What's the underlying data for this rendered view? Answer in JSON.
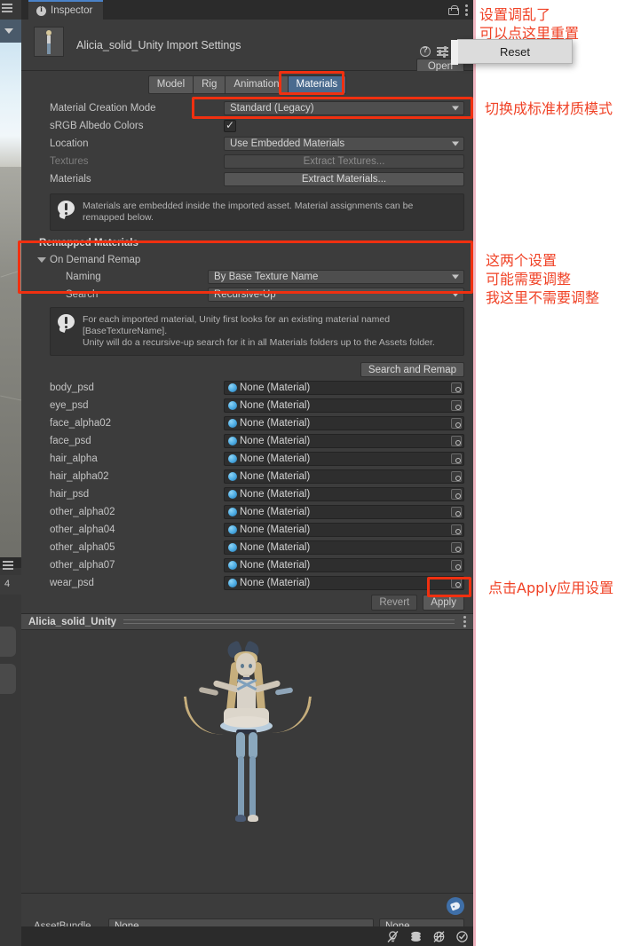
{
  "window": {
    "tab_title": "Inspector",
    "lock_icon": "lock-icon",
    "menu_icon": "kebab-menu-icon"
  },
  "asset_header": {
    "title": "Alicia_solid_Unity Import Settings",
    "help_icon": "help-icon",
    "preset_icon": "preset-icon",
    "menu_icon": "kebab-menu-icon",
    "open_button": "Open"
  },
  "context_menu": {
    "items": [
      "Reset"
    ]
  },
  "tabs": [
    {
      "label": "Model",
      "active": false
    },
    {
      "label": "Rig",
      "active": false
    },
    {
      "label": "Animation",
      "active": false
    },
    {
      "label": "Materials",
      "active": true
    }
  ],
  "material_settings": {
    "creation_mode_label": "Material Creation Mode",
    "creation_mode_value": "Standard (Legacy)",
    "srgb_label": "sRGB Albedo Colors",
    "srgb_checked": true,
    "location_label": "Location",
    "location_value": "Use Embedded Materials",
    "textures_label": "Textures",
    "textures_button": "Extract Textures...",
    "materials_label": "Materials",
    "materials_button": "Extract Materials...",
    "info_text": "Materials are embedded inside the imported asset. Material assignments can be remapped below."
  },
  "remapped": {
    "section_title": "Remapped Materials",
    "fold_label": "On Demand Remap",
    "naming_label": "Naming",
    "naming_value": "By Base Texture Name",
    "search_label": "Search",
    "search_value": "Recursive-Up",
    "info_text": "For each imported material, Unity first looks for an existing material named [BaseTextureName].\nUnity will do a recursive-up search for it in all Materials folders up to the Assets folder.",
    "search_remap_button": "Search and Remap"
  },
  "material_list": [
    {
      "name": "body_psd",
      "value": "None (Material)"
    },
    {
      "name": "eye_psd",
      "value": "None (Material)"
    },
    {
      "name": "face_alpha02",
      "value": "None (Material)"
    },
    {
      "name": "face_psd",
      "value": "None (Material)"
    },
    {
      "name": "hair_alpha",
      "value": "None (Material)"
    },
    {
      "name": "hair_alpha02",
      "value": "None (Material)"
    },
    {
      "name": "hair_psd",
      "value": "None (Material)"
    },
    {
      "name": "other_alpha02",
      "value": "None (Material)"
    },
    {
      "name": "other_alpha04",
      "value": "None (Material)"
    },
    {
      "name": "other_alpha05",
      "value": "None (Material)"
    },
    {
      "name": "other_alpha07",
      "value": "None (Material)"
    },
    {
      "name": "wear_psd",
      "value": "None (Material)"
    }
  ],
  "footer_buttons": {
    "revert": "Revert",
    "apply": "Apply"
  },
  "preview": {
    "title": "Alicia_solid_Unity",
    "menu_icon": "kebab-menu-icon",
    "toolbar_icons": [
      "lighting-off-icon",
      "animation-icon",
      "wireframe-off-icon",
      "checkmark-icon"
    ]
  },
  "assetbundle": {
    "label": "AssetBundle",
    "name_value": "None",
    "variant_value": "None",
    "tag_icon": "tag-icon"
  },
  "annotations": [
    {
      "id": "reset-note",
      "lines": [
        "设置调乱了",
        "可以点这里重置"
      ]
    },
    {
      "id": "mode-note",
      "lines": [
        "切换成标准材质模式"
      ]
    },
    {
      "id": "remap-note",
      "lines": [
        "这两个设置",
        "可能需要调整",
        "我这里不需要调整"
      ]
    },
    {
      "id": "apply-note",
      "lines": [
        "点击Apply应用设置"
      ]
    }
  ],
  "colors": {
    "annotation_red": "#f04226",
    "highlight_box": "#f03010",
    "active_tab_blue": "#4a6b8f",
    "panel_bg": "#3c3c3c"
  },
  "left_strip": {
    "tab_number": "4"
  }
}
